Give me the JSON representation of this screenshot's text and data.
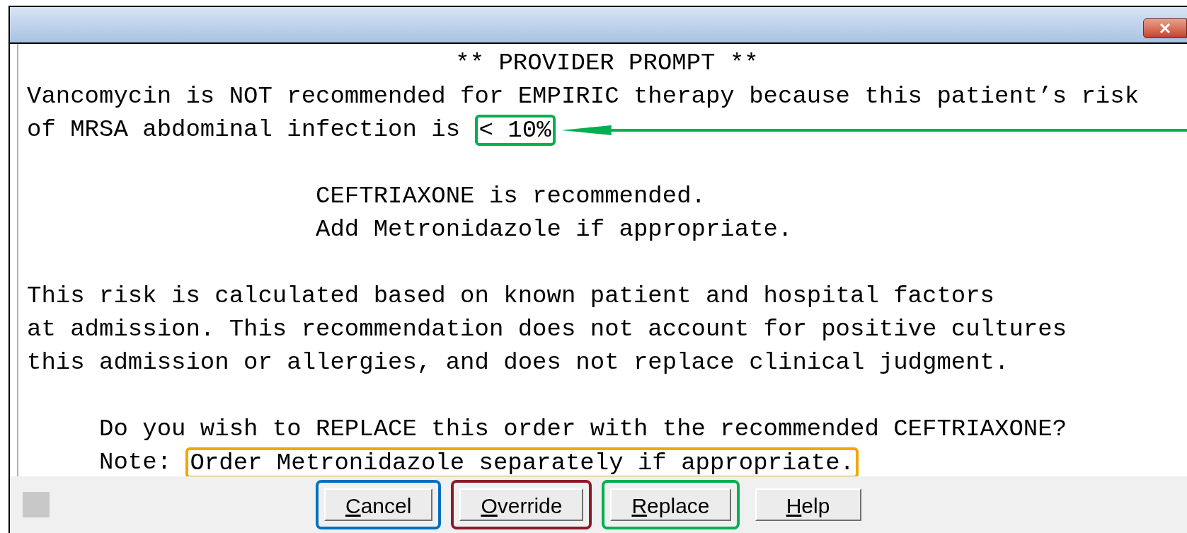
{
  "message": [
    {
      "kind": "header",
      "lines": [
        {
          "text": "** PROVIDER PROMPT **"
        }
      ]
    },
    {
      "kind": "lead",
      "lines": [
        {
          "text": "Vancomycin is NOT recommended for EMPIRIC therapy because this patient’s risk"
        },
        {
          "text": "of MRSA abdominal infection is ",
          "highlight": {
            "text": "< 10%",
            "color": "#00b050",
            "arrow": true
          }
        }
      ]
    },
    {
      "kind": "recommend",
      "lines": [
        {
          "text": "CEFTRIAXONE is recommended."
        },
        {
          "text": "Add Metronidazole if appropriate."
        }
      ]
    },
    {
      "kind": "body",
      "lines": [
        {
          "text": "This risk is calculated based on known patient and hospital factors"
        },
        {
          "text": "at admission. This recommendation does not account for positive cultures"
        },
        {
          "text": "this admission or allergies, and does not replace clinical judgment."
        }
      ]
    },
    {
      "kind": "question",
      "lines": [
        {
          "text": "Do you wish to REPLACE this order with the recommended CEFTRIAXONE?"
        },
        {
          "text": "Note: ",
          "highlight": {
            "text": "Order Metronidazole separately if appropriate.",
            "color": "#f0a800",
            "arrow": false
          }
        }
      ]
    }
  ],
  "buttons": [
    {
      "label": "Cancel",
      "color": "#0070c0"
    },
    {
      "label": "Override",
      "color": "#8b1a2b"
    },
    {
      "label": "Replace",
      "color": "#00b050"
    },
    {
      "label": "Help"
    }
  ]
}
